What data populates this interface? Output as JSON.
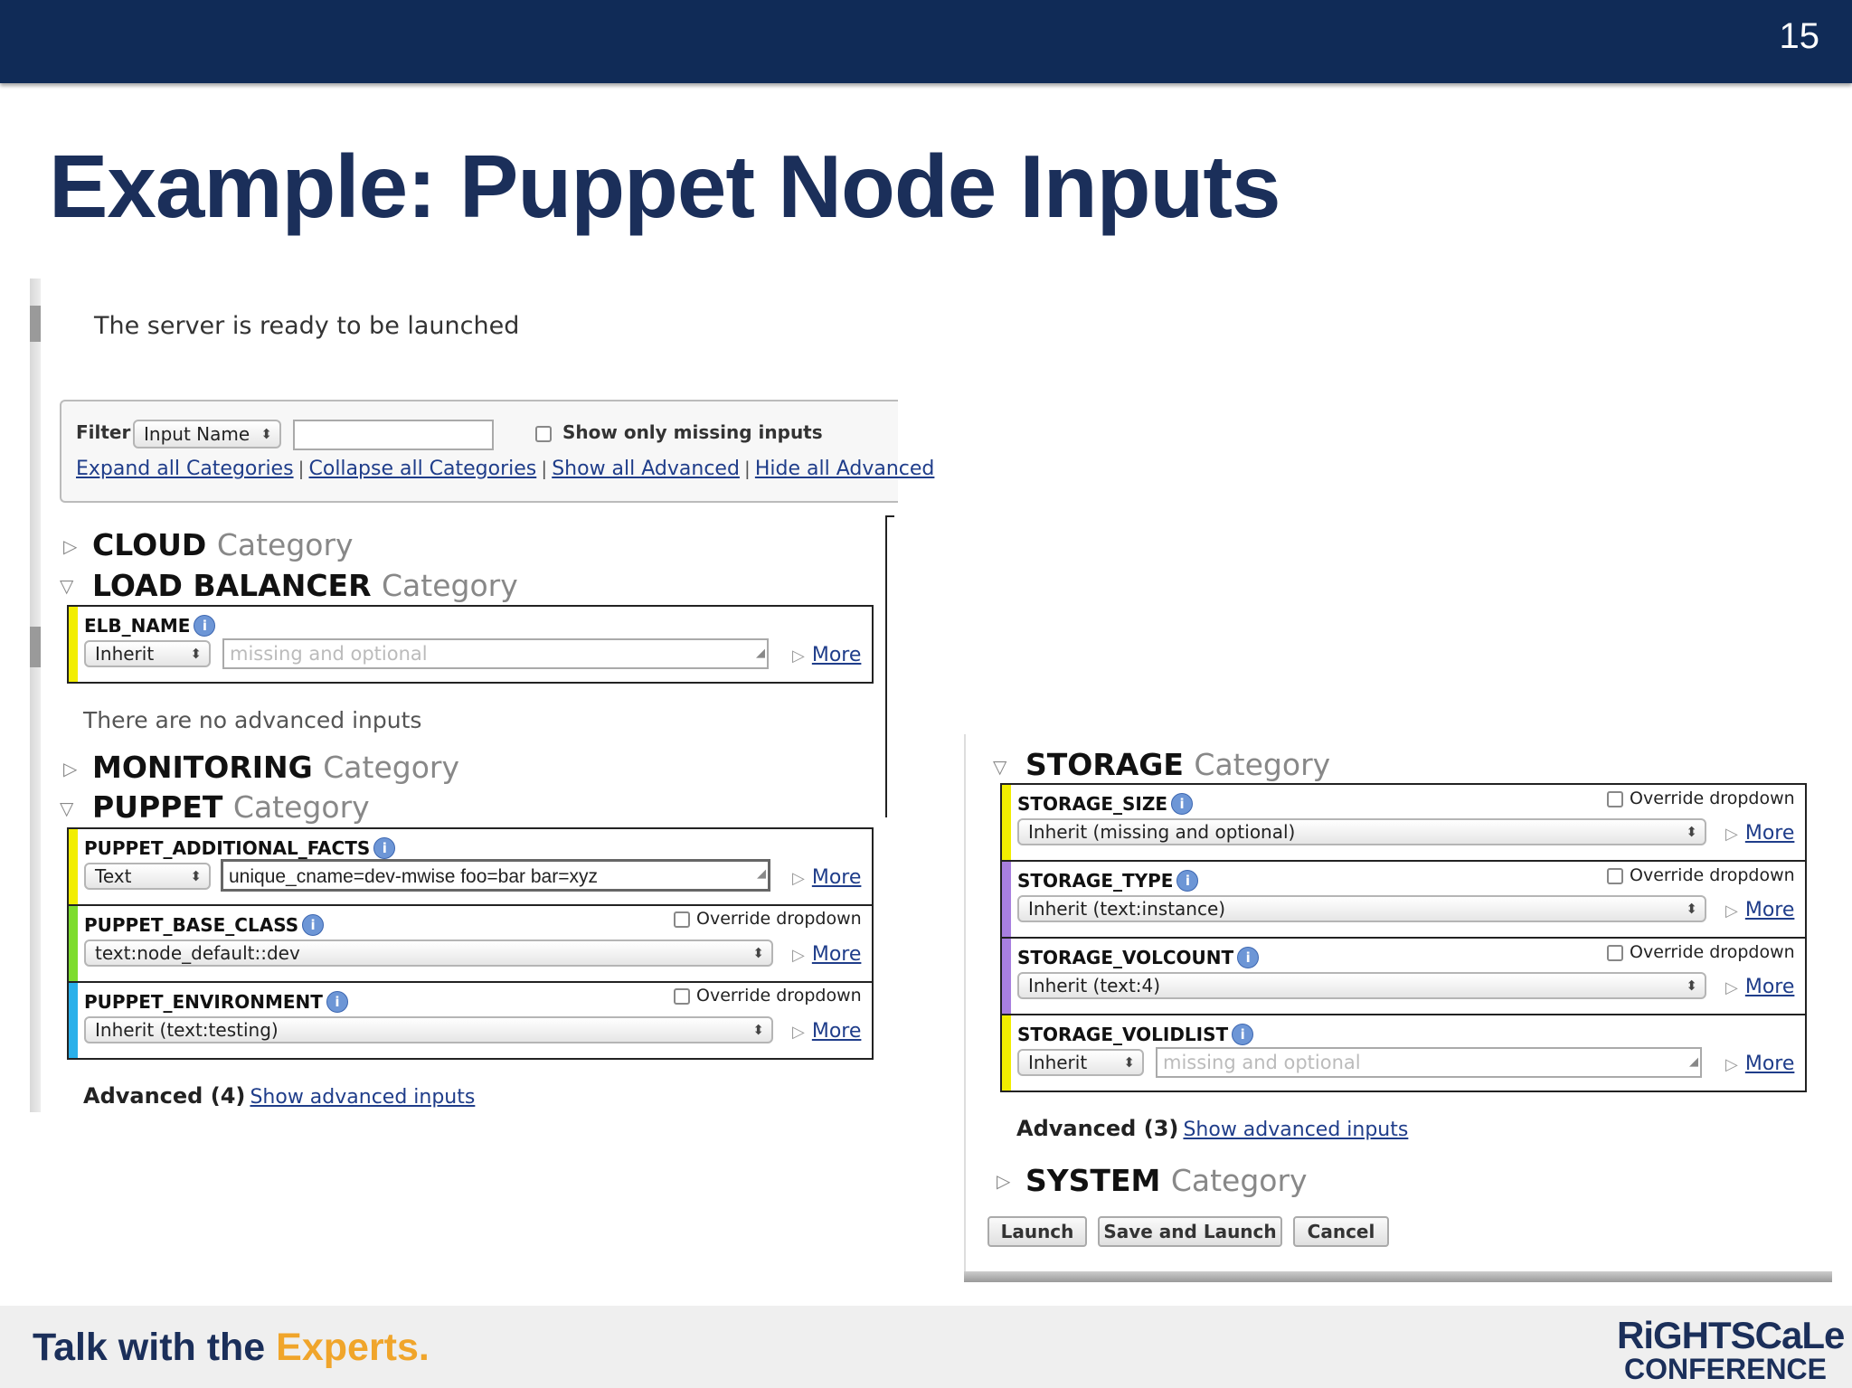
{
  "slide": {
    "number": "15",
    "title": "Example: Puppet Node Inputs",
    "tagline_main": "Talk with the ",
    "tagline_accent": "Experts.",
    "logo_line1": "RiGHTSCaLe",
    "logo_line2": "CONFERENCE",
    "colors": {
      "header_bar": "#102b57",
      "title": "#1b2f5a",
      "accent": "#f0a52b"
    }
  },
  "left_panel": {
    "status_text": "The server is ready to be launched",
    "filter": {
      "label": "Filter",
      "select_value": "Input Name",
      "search_value": "",
      "missing_checkbox_label": "Show only missing inputs",
      "links": [
        "Expand all Categories",
        "Collapse all Categories",
        "Show all Advanced",
        "Hide all Advanced"
      ],
      "separator": "|"
    },
    "categories": {
      "cloud": {
        "name": "CLOUD",
        "suffix": "Category"
      },
      "load_balancer": {
        "name": "LOAD BALANCER",
        "suffix": "Category"
      },
      "monitoring": {
        "name": "MONITORING",
        "suffix": "Category"
      },
      "puppet": {
        "name": "PUPPET",
        "suffix": "Category"
      }
    },
    "elb_name": {
      "label": "ELB_NAME",
      "select": "Inherit",
      "placeholder": "missing and optional",
      "more": "More"
    },
    "no_advanced": "There are no advanced inputs",
    "puppet_additional_facts": {
      "label": "PUPPET_ADDITIONAL_FACTS",
      "select": "Text",
      "value": "unique_cname=dev-mwise foo=bar bar=xyz",
      "more": "More"
    },
    "puppet_base_class": {
      "label": "PUPPET_BASE_CLASS",
      "override": "Override dropdown",
      "select": "text:node_default::dev",
      "more": "More"
    },
    "puppet_environment": {
      "label": "PUPPET_ENVIRONMENT",
      "override": "Override dropdown",
      "select": "Inherit (text:testing)",
      "more": "More"
    },
    "advanced": {
      "label": "Advanced (4)",
      "link": "Show advanced inputs"
    },
    "stripe_colors": {
      "elb": "#f2ee00",
      "facts": "#f2ee00",
      "base": "#7ddc2e",
      "env": "#2ab0ea"
    }
  },
  "right_panel": {
    "storage": {
      "name": "STORAGE",
      "suffix": "Category"
    },
    "storage_size": {
      "label": "STORAGE_SIZE",
      "override": "Override dropdown",
      "select": "Inherit (missing and optional)",
      "more": "More"
    },
    "storage_type": {
      "label": "STORAGE_TYPE",
      "override": "Override dropdown",
      "select": "Inherit (text:instance)",
      "more": "More"
    },
    "storage_volcount": {
      "label": "STORAGE_VOLCOUNT",
      "override": "Override dropdown",
      "select": "Inherit (text:4)",
      "more": "More"
    },
    "storage_volidlist": {
      "label": "STORAGE_VOLIDLIST",
      "select": "Inherit",
      "placeholder": "missing and optional",
      "more": "More"
    },
    "advanced": {
      "label": "Advanced (3)",
      "link": "Show advanced inputs"
    },
    "system": {
      "name": "SYSTEM",
      "suffix": "Category"
    },
    "buttons": {
      "launch": "Launch",
      "save_launch": "Save and Launch",
      "cancel": "Cancel"
    },
    "stripe_colors": {
      "size": "#f2ee00",
      "type": "#a87fe0",
      "volcount": "#a87fe0",
      "volidlist": "#f2ee00"
    }
  }
}
